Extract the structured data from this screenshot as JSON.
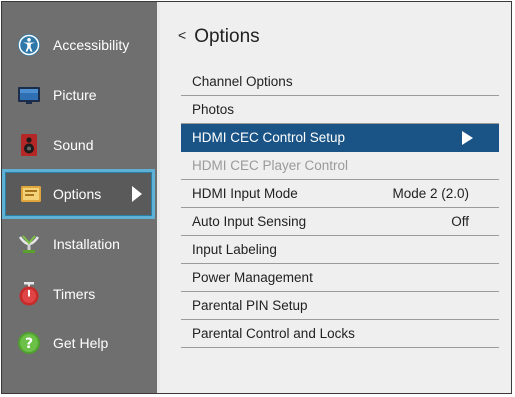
{
  "sidebar": {
    "items": [
      {
        "label": "Accessibility",
        "icon": "accessibility-icon"
      },
      {
        "label": "Picture",
        "icon": "picture-icon"
      },
      {
        "label": "Sound",
        "icon": "speaker-icon"
      },
      {
        "label": "Options",
        "icon": "options-icon",
        "selected": true
      },
      {
        "label": "Installation",
        "icon": "satellite-icon"
      },
      {
        "label": "Timers",
        "icon": "timer-icon"
      },
      {
        "label": "Get Help",
        "icon": "help-icon"
      }
    ]
  },
  "header": {
    "back_symbol": "<",
    "title": "Options"
  },
  "menu": {
    "items": [
      {
        "label": "Channel Options",
        "value": ""
      },
      {
        "label": "Photos",
        "value": ""
      },
      {
        "label": "HDMI CEC Control Setup",
        "value": "",
        "state": "highlighted"
      },
      {
        "label": "HDMI CEC  Player Control",
        "value": "",
        "state": "disabled"
      },
      {
        "label": "HDMI Input Mode",
        "value": "Mode 2 (2.0)"
      },
      {
        "label": "Auto Input Sensing",
        "value": "Off"
      },
      {
        "label": "Input Labeling",
        "value": ""
      },
      {
        "label": "Power Management",
        "value": ""
      },
      {
        "label": "Parental PIN Setup",
        "value": ""
      },
      {
        "label": "Parental Control and Locks",
        "value": ""
      }
    ]
  },
  "colors": {
    "sidebar_bg": "#6f6f6f",
    "highlight": "#1a5486",
    "selection_outline": "#5fb0d5"
  }
}
